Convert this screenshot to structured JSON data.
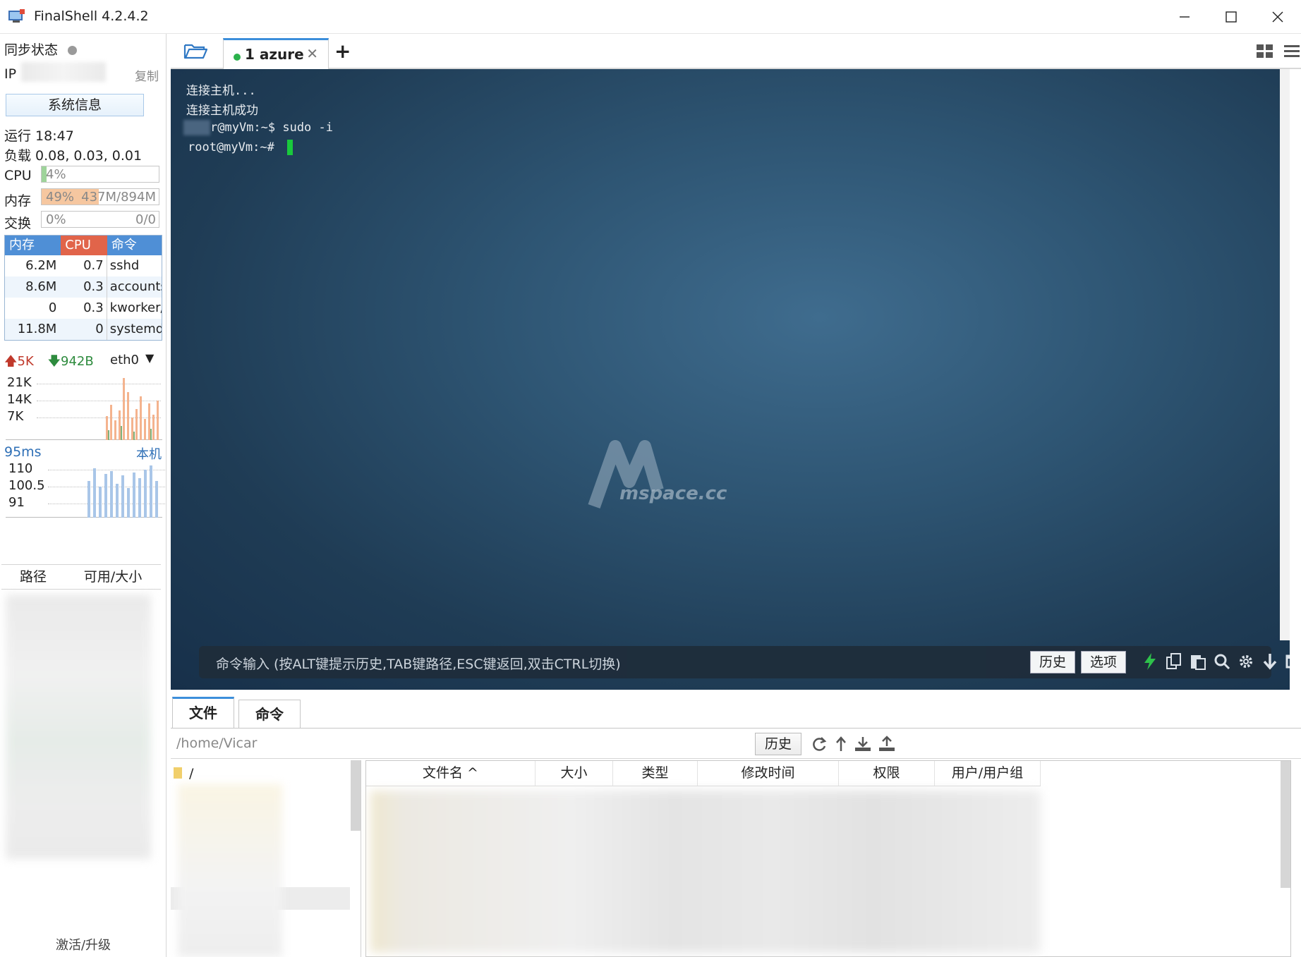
{
  "window": {
    "title": "FinalShell 4.2.4.2"
  },
  "sidebar": {
    "sync_label": "同步状态",
    "ip_label": "IP",
    "copy_label": "复制",
    "sysinfo_button": "系统信息",
    "uptime": "运行 18:47",
    "load": "负载 0.08, 0.03, 0.01",
    "cpu": {
      "label": "CPU",
      "percent_text": "4%",
      "fraction": 0.04,
      "color": "#9ed39a"
    },
    "mem": {
      "label": "内存",
      "percent_text": "49%",
      "detail": "437M/894M",
      "fraction": 0.49,
      "color": "#f6c7a0"
    },
    "swap": {
      "label": "交换",
      "percent_text": "0%",
      "detail": "0/0",
      "fraction": 0
    },
    "process_table": {
      "headers": [
        "内存",
        "CPU",
        "命令"
      ],
      "header_colors": [
        "#4f8fd6",
        "#e1644a",
        "#4f8fd6"
      ],
      "rows": [
        {
          "mem": "6.2M",
          "cpu": "0.7",
          "cmd": "sshd"
        },
        {
          "mem": "8.6M",
          "cpu": "0.3",
          "cmd": "accounts"
        },
        {
          "mem": "0",
          "cpu": "0.3",
          "cmd": "kworker/"
        },
        {
          "mem": "11.8M",
          "cpu": "0",
          "cmd": "systemd"
        }
      ]
    },
    "network": {
      "up": "5K",
      "down": "942B",
      "interface": "eth0",
      "y_ticks": [
        "21K",
        "14K",
        "7K"
      ]
    },
    "latency": {
      "value": "95ms",
      "target": "本机",
      "y_ticks": [
        "110",
        "100.5",
        "91"
      ]
    },
    "disk_table": {
      "headers": [
        "路径",
        "可用/大小"
      ]
    },
    "activate_label": "激活/升级"
  },
  "tabs": {
    "active_tab": {
      "index": "1",
      "name": "azure",
      "status_color": "#2bb24c"
    }
  },
  "terminal": {
    "lines": [
      "连接主机...",
      "连接主机成功",
      "r@myVm:~$ sudo -i",
      "root@myVm:~# "
    ],
    "watermark": "mspace.cc",
    "command_hint": "命令输入 (按ALT键提示历史,TAB键路径,ESC键返回,双击CTRL切换)",
    "history_button": "历史",
    "options_button": "选项"
  },
  "file_panel": {
    "tabs": [
      "文件",
      "命令"
    ],
    "path": "/home/Vicar",
    "history_button": "历史",
    "tree_root": "/",
    "columns": [
      "文件名 ^",
      "大小",
      "类型",
      "修改时间",
      "权限",
      "用户/用户组"
    ]
  }
}
